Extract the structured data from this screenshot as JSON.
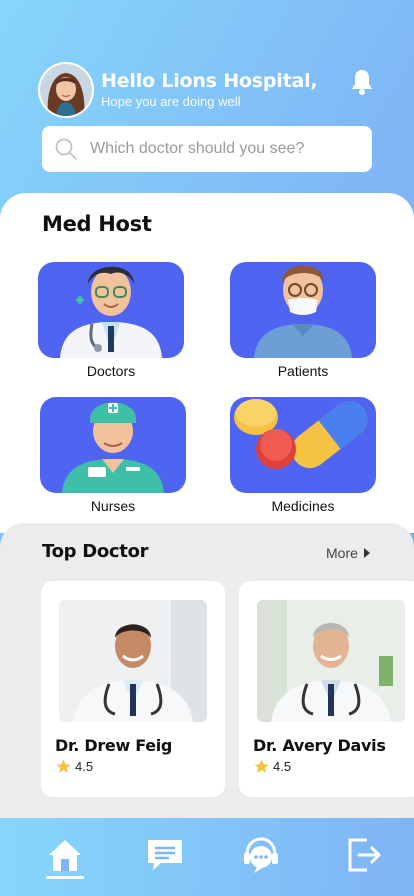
{
  "header": {
    "greeting": "Hello Lions Hospital,",
    "subtitle": "Hope you are doing well"
  },
  "search": {
    "placeholder": "Which doctor should you see?",
    "value": ""
  },
  "categories_section": {
    "title": "Med Host",
    "items": [
      {
        "label": "Doctors",
        "icon": "doctor-illustration"
      },
      {
        "label": "Patients",
        "icon": "patient-illustration"
      },
      {
        "label": "Nurses",
        "icon": "nurse-illustration"
      },
      {
        "label": "Medicines",
        "icon": "medicines-illustration"
      }
    ]
  },
  "top_doctors": {
    "title": "Top Doctor",
    "more_label": "More",
    "doctors": [
      {
        "name": "Dr. Drew Feig",
        "rating": "4.5"
      },
      {
        "name": "Dr. Avery Davis",
        "rating": "4.5"
      }
    ]
  },
  "bottom_nav": {
    "items": [
      {
        "icon": "home-icon",
        "active": true
      },
      {
        "icon": "chat-icon",
        "active": false
      },
      {
        "icon": "support-icon",
        "active": false
      },
      {
        "icon": "logout-icon",
        "active": false
      }
    ]
  },
  "colors": {
    "gradient_start": "#86d6fb",
    "gradient_end": "#76a7f3",
    "tile_blue": "#4f64f0",
    "panel_white": "#ffffff",
    "section_gray": "#ececec",
    "star_yellow": "#f5c242"
  }
}
